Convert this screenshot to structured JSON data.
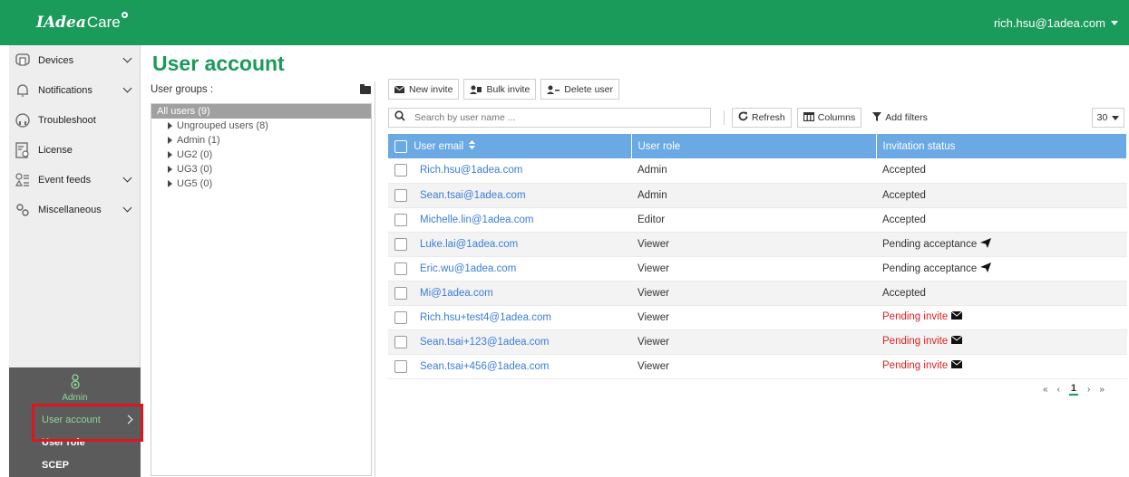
{
  "app": {
    "logo_main": "IAdea",
    "logo_sub": "Care",
    "user_email": "rich.hsu@1adea.com"
  },
  "sidebar": {
    "items": [
      {
        "label": "Devices",
        "icon": "devices-icon"
      },
      {
        "label": "Notifications",
        "icon": "bell-icon"
      },
      {
        "label": "Troubleshoot",
        "icon": "troubleshoot-icon"
      },
      {
        "label": "License",
        "icon": "license-icon"
      },
      {
        "label": "Event feeds",
        "icon": "event-feeds-icon"
      },
      {
        "label": "Miscellaneous",
        "icon": "miscellaneous-icon"
      }
    ],
    "admin": {
      "label": "Admin",
      "subitems": [
        "User account",
        "User role",
        "SCEP"
      ]
    }
  },
  "page": {
    "title": "User account"
  },
  "groups": {
    "header": "User groups :",
    "items": [
      "All users (9)",
      "Ungrouped users (8)",
      "Admin (1)",
      "UG2 (0)",
      "UG3 (0)",
      "UG5 (0)"
    ]
  },
  "toolbar": {
    "new_invite": "New invite",
    "bulk_invite": "Bulk invite",
    "delete_user": "Delete user"
  },
  "search": {
    "placeholder": "Search by user name ...",
    "refresh": "Refresh",
    "columns": "Columns",
    "add_filters": "Add filters",
    "page_size": "30"
  },
  "table": {
    "headers": [
      "User email",
      "User role",
      "Invitation status"
    ],
    "rows": [
      {
        "email": "Rich.hsu@1adea.com",
        "role": "Admin",
        "status": "Accepted",
        "status_type": "accepted"
      },
      {
        "email": "Sean.tsai@1adea.com",
        "role": "Admin",
        "status": "Accepted",
        "status_type": "accepted"
      },
      {
        "email": "Michelle.lin@1adea.com",
        "role": "Editor",
        "status": "Accepted",
        "status_type": "accepted"
      },
      {
        "email": "Luke.lai@1adea.com",
        "role": "Viewer",
        "status": "Pending acceptance",
        "status_type": "pending-acceptance"
      },
      {
        "email": "Eric.wu@1adea.com",
        "role": "Viewer",
        "status": "Pending acceptance",
        "status_type": "pending-acceptance"
      },
      {
        "email": "Mi@1adea.com",
        "role": "Viewer",
        "status": "Accepted",
        "status_type": "accepted"
      },
      {
        "email": "Rich.hsu+test4@1adea.com",
        "role": "Viewer",
        "status": "Pending invite",
        "status_type": "pending-invite"
      },
      {
        "email": "Sean.tsai+123@1adea.com",
        "role": "Viewer",
        "status": "Pending invite",
        "status_type": "pending-invite"
      },
      {
        "email": "Sean.tsai+456@1adea.com",
        "role": "Viewer",
        "status": "Pending invite",
        "status_type": "pending-invite"
      }
    ]
  },
  "pagination": {
    "first": "«",
    "prev": "‹",
    "current": "1",
    "next": "›",
    "last": "»"
  },
  "colors": {
    "brand": "#1a9b5a",
    "header_blue": "#6aa9e3",
    "link": "#3b7dd8",
    "pending": "#e02020",
    "highlight": "#e0141b"
  }
}
